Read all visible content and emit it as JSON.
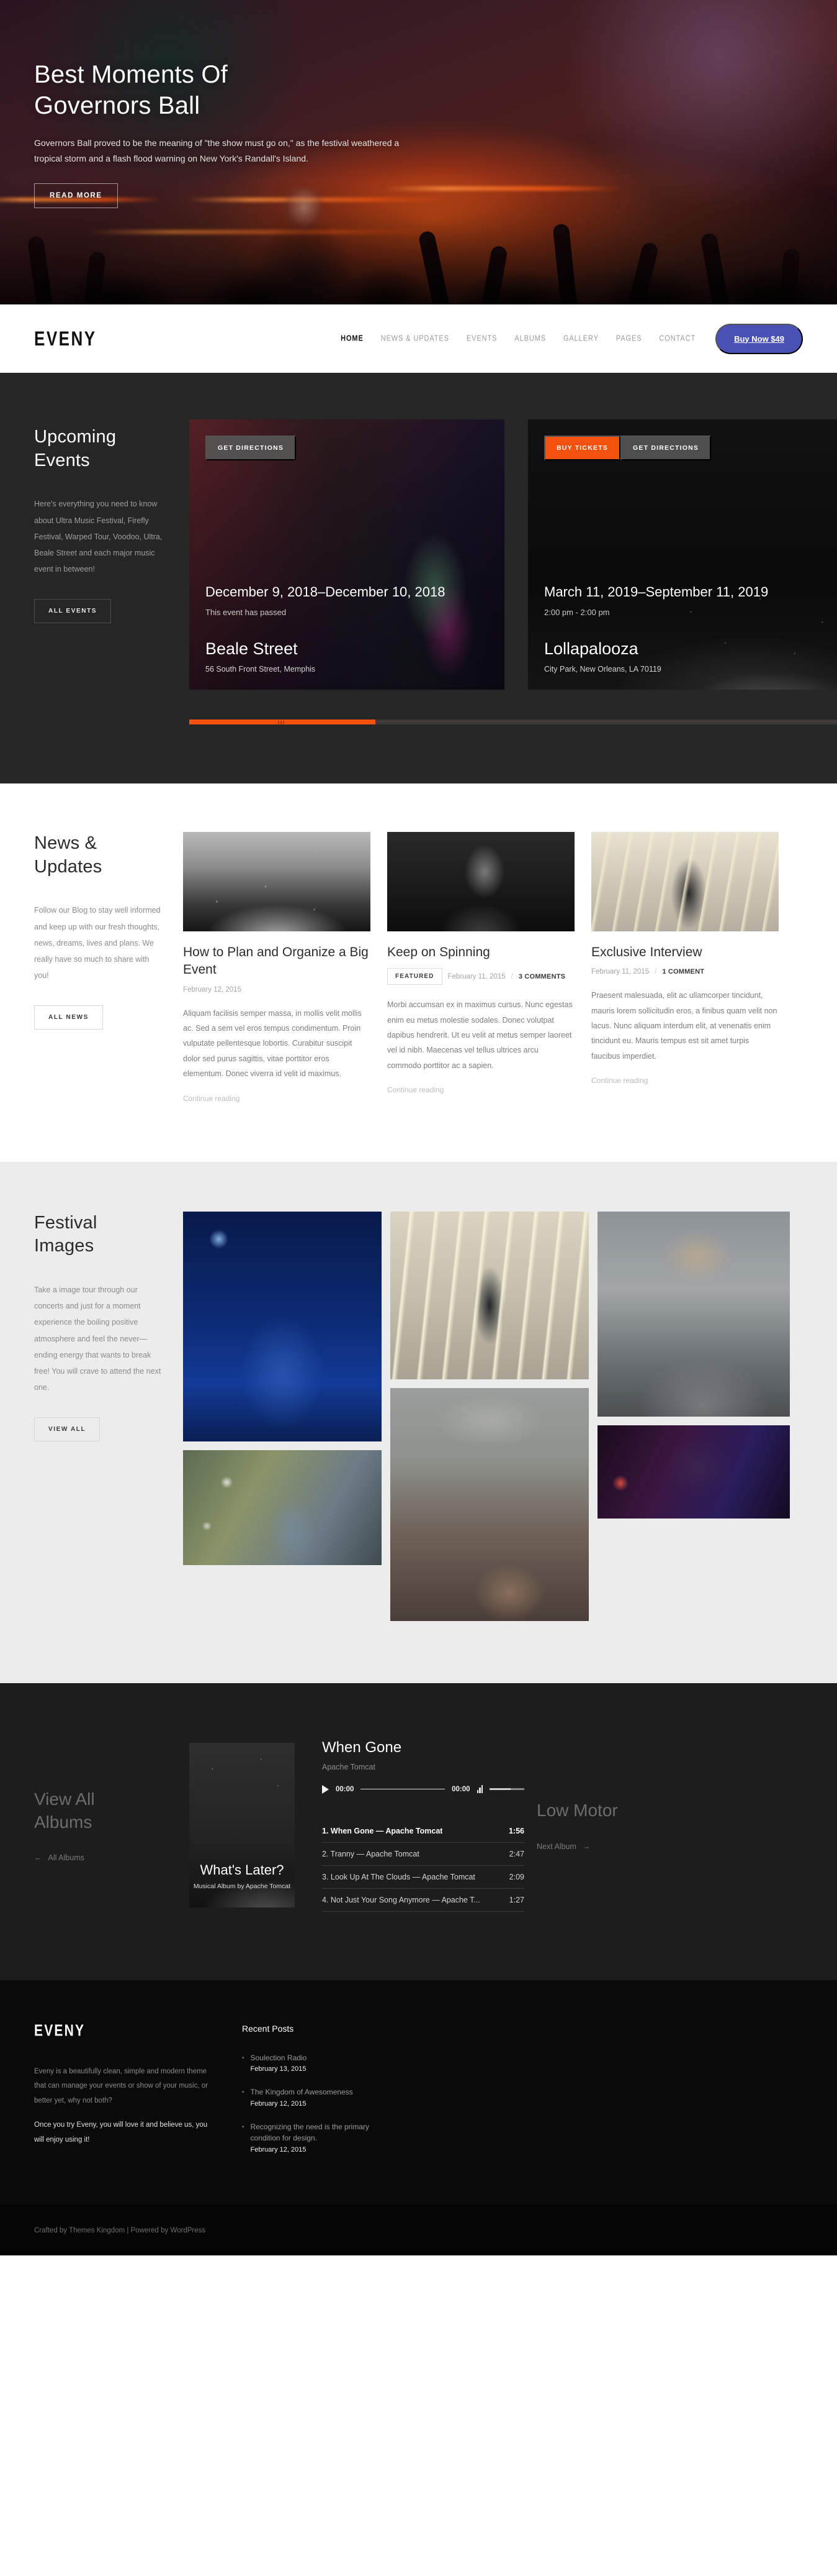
{
  "hero": {
    "title_line1": "Best Moments Of",
    "title_line2": "Governors Ball",
    "description": "Governors Ball proved to be the meaning of \"the show must go on,\" as the festival weathered a tropical storm and a flash flood warning on New York's Randall's Island.",
    "cta": "READ MORE"
  },
  "nav": {
    "logo": "EVENY",
    "links": [
      {
        "label": "HOME",
        "active": true
      },
      {
        "label": "NEWS & UPDATES",
        "active": false
      },
      {
        "label": "EVENTS",
        "active": false
      },
      {
        "label": "ALBUMS",
        "active": false
      },
      {
        "label": "GALLERY",
        "active": false
      },
      {
        "label": "PAGES",
        "active": false
      },
      {
        "label": "CONTACT",
        "active": false
      }
    ],
    "buy_button": "Buy Now $49"
  },
  "events": {
    "title_line1": "Upcoming",
    "title_line2": "Events",
    "body": "Here's everything you need to know about Ultra Music Festival, Firefly Festival, Warped Tour, Voodoo, Ultra, Beale Street and each major music event in between!",
    "cta": "ALL EVENTS",
    "cards": [
      {
        "buttons": [
          {
            "label": "GET DIRECTIONS",
            "style": "grey"
          }
        ],
        "date": "December 9, 2018–December 10, 2018",
        "sub": "This event has passed",
        "name": "Beale Street",
        "address": "56 South Front Street, Memphis"
      },
      {
        "buttons": [
          {
            "label": "BUY TICKETS",
            "style": "orange"
          },
          {
            "label": "GET DIRECTIONS",
            "style": "grey"
          }
        ],
        "date": "March 11, 2019–September 11, 2019",
        "sub": "2:00 pm - 2:00 pm",
        "name": "Lollapalooza",
        "address": "City Park, New Orleans, LA 70119"
      }
    ]
  },
  "news": {
    "title_line1": "News &",
    "title_line2": "Updates",
    "body": "Follow our Blog to stay well informed and keep up with our fresh thoughts, news, dreams, lives and plans. We really have so much to share with you!",
    "cta": "ALL NEWS",
    "more_label": "Continue reading",
    "articles": [
      {
        "thumb": "crowd",
        "title": "How to Plan and Organize a Big Event",
        "featured": "",
        "date": "February 12, 2015",
        "comments": "",
        "excerpt": "Aliquam facilisis semper massa, in mollis velit mollis ac. Sed a sem vel eros tempus condimentum. Proin vulputate pellentesque lobortis. Curabitur suscipit dolor sed purus sagittis, vitae porttitor eros elementum. Donec viverra id velit id maximus."
      },
      {
        "thumb": "guitar",
        "title": "Keep on Spinning",
        "featured": "FEATURED",
        "date": "February 11, 2015",
        "comments": "3 COMMENTS",
        "excerpt": "Morbi accumsan ex in maximus cursus. Nunc egestas enim eu metus molestie sodales. Donec volutpat dapibus hendrerit. Ut eu velit at metus semper laoreet vel id nibh. Maecenas vel tellus ultrices arcu commodo porttitor ac a sapien."
      },
      {
        "thumb": "neon",
        "title": "Exclusive Interview",
        "featured": "",
        "date": "February 11, 2015",
        "comments": "1 COMMENT",
        "excerpt": "Praesent malesuada, elit ac ullamcorper tincidunt, mauris lorem sollicitudin eros, a finibus quam velit non lacus. Nunc aliquam interdum elit, at venenatis enim tincidunt eu. Mauris tempus est sit amet turpis faucibus imperdiet."
      }
    ]
  },
  "gallery": {
    "title_line1": "Festival",
    "title_line2": "Images",
    "body": "Take a image tour through our concerts and just for a moment experience the boiling positive atmosphere and feel the never—ending energy that wants to break free! You will crave to attend the next one.",
    "cta": "VIEW ALL"
  },
  "album": {
    "prev_title_line1": "View All",
    "prev_title_line2": "Albums",
    "prev_link": "All Albums",
    "cover_title": "What's Later?",
    "cover_sub": "Musical Album by Apache Tomcat",
    "player": {
      "track_title": "When Gone",
      "artist": "Apache Tomcat",
      "current_time": "00:00",
      "total_time": "00:00"
    },
    "tracks": [
      {
        "label": "1. When Gone — Apache Tomcat",
        "time": "1:56",
        "active": true
      },
      {
        "label": "2. Tranny — Apache Tomcat",
        "time": "2:47",
        "active": false
      },
      {
        "label": "3. Look Up At The Clouds — Apache Tomcat",
        "time": "2:09",
        "active": false
      },
      {
        "label": "4. Not Just Your Song Anymore — Apache T...",
        "time": "1:27",
        "active": false
      }
    ],
    "next_title": "Low Motor",
    "next_link": "Next Album"
  },
  "footer": {
    "logo": "EVENY",
    "about_1": "Eveny is a beautifully clean, simple and modern theme that can manage your events or show of your music, or better yet, why not both?",
    "about_2": "Once you try Eveny, you will love it and believe us, you will enjoy using it!",
    "recent_heading": "Recent Posts",
    "recent_posts": [
      {
        "title": "Soulection Radio",
        "date": "February 13, 2015"
      },
      {
        "title": "The Kingdom of Awesomeness",
        "date": "February 12, 2015"
      },
      {
        "title": "Recognizing the need is the primary condition for design.",
        "date": "February 12, 2015"
      }
    ],
    "copyright": "Crafted by Themes Kingdom | Powered by WordPress"
  },
  "colors": {
    "accent_orange": "#f4510d",
    "accent_blue": "#4a51b5",
    "dark_bg": "#262626",
    "album_bg": "#1d1d1d",
    "gallery_bg": "#ececec"
  }
}
